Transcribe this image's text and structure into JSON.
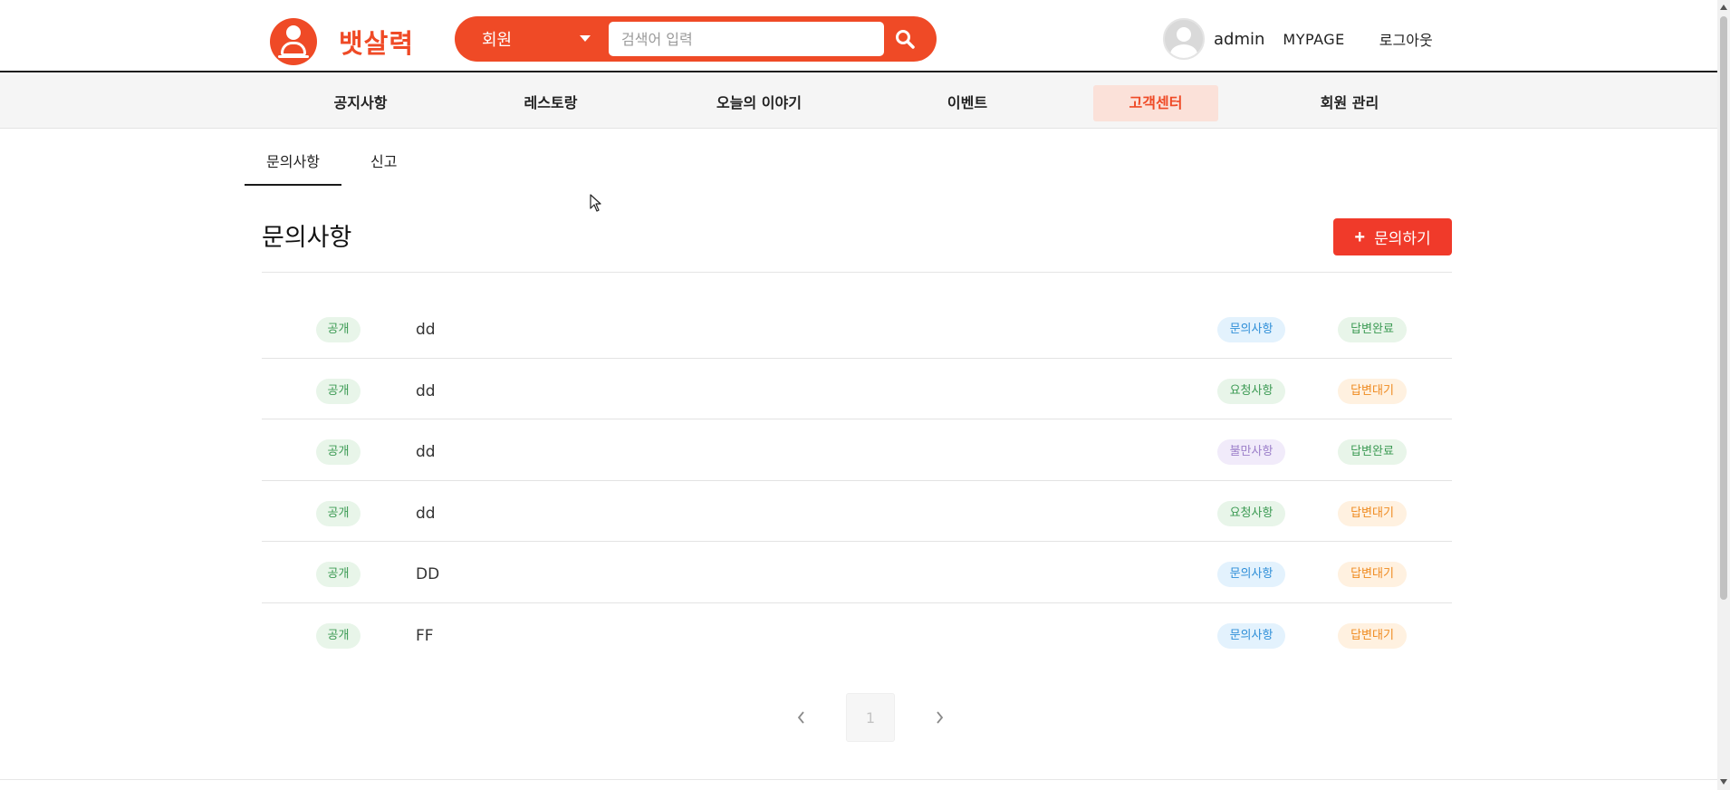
{
  "header": {
    "logo_text": "뱃살력",
    "search": {
      "category_value": "회원",
      "placeholder": "검색어 입력"
    },
    "user": {
      "name": "admin",
      "mypage_label": "MYPAGE",
      "logout_label": "로그아웃"
    }
  },
  "nav": {
    "items": [
      {
        "label": "공지사항"
      },
      {
        "label": "레스토랑"
      },
      {
        "label": "오늘의 이야기"
      },
      {
        "label": "이벤트"
      },
      {
        "label": "고객센터",
        "active": true
      },
      {
        "label": "회원 관리"
      }
    ]
  },
  "tabs": [
    {
      "label": "문의사항",
      "active": true
    },
    {
      "label": "신고"
    }
  ],
  "main": {
    "title": "문의사항",
    "ask_button_label": "문의하기",
    "rows": [
      {
        "visibility": "공개",
        "title": "dd",
        "category": "문의사항",
        "status": "답변완료"
      },
      {
        "visibility": "공개",
        "title": "dd",
        "category": "요청사항",
        "status": "답변대기"
      },
      {
        "visibility": "공개",
        "title": "dd",
        "category": "불만사항",
        "status": "답변완료"
      },
      {
        "visibility": "공개",
        "title": "dd",
        "category": "요청사항",
        "status": "답변대기"
      },
      {
        "visibility": "공개",
        "title": "DD",
        "category": "문의사항",
        "status": "답변대기"
      },
      {
        "visibility": "공개",
        "title": "FF",
        "category": "문의사항",
        "status": "답변대기"
      }
    ]
  },
  "pagination": {
    "current_page": "1"
  },
  "colors": {
    "brand": "#ef4a26",
    "nav_active_bg": "#fbe1d9",
    "ask_button": "#f03a2a",
    "category": {
      "문의사항": {
        "bg": "#e3f2fd",
        "fg": "#2f8fd8"
      },
      "요청사항": {
        "bg": "#e8f5e9",
        "fg": "#3b9a53"
      },
      "불만사항": {
        "bg": "#f1ebfa",
        "fg": "#9b7ec9"
      }
    },
    "status": {
      "답변완료": {
        "bg": "#e8f5e9",
        "fg": "#3b9a53"
      },
      "답변대기": {
        "bg": "#fff1e0",
        "fg": "#ef8a1f"
      }
    }
  },
  "icons": {
    "logo": "chef-logo-icon",
    "search": "search-icon",
    "dropdown": "chevron-down-icon",
    "avatar": "user-avatar-icon",
    "plus": "plus-icon",
    "prev": "chevron-left-icon",
    "next": "chevron-right-icon",
    "cursor": "mouse-cursor-icon"
  }
}
